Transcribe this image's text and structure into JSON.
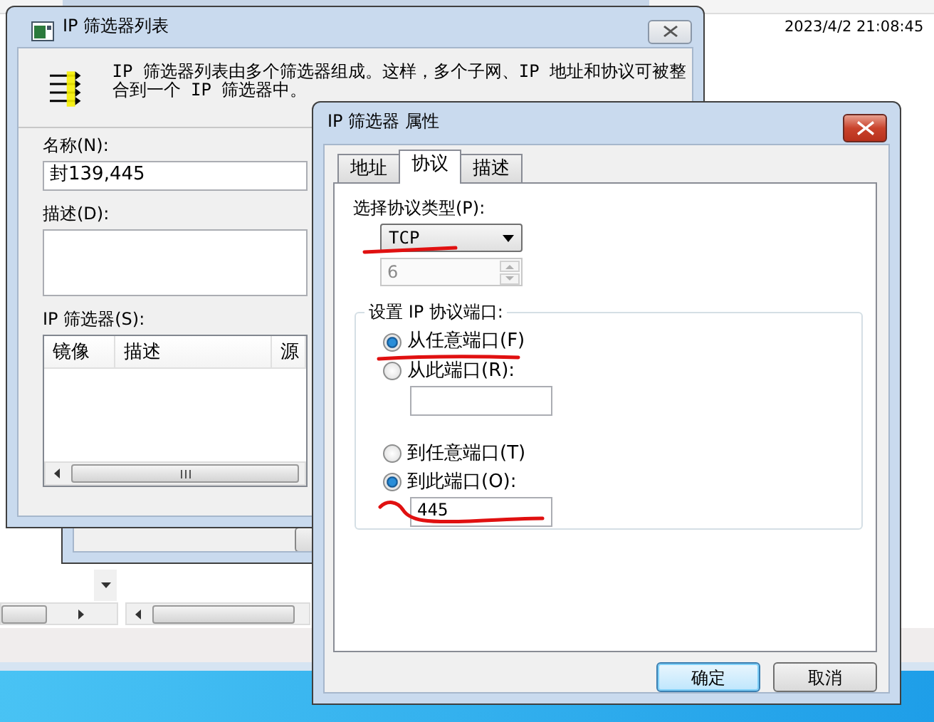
{
  "background_window": {
    "timestamp": "2023/4/2 21:08:45"
  },
  "filter_list_window": {
    "title": "IP 筛选器列表",
    "intro": "IP 筛选器列表由多个筛选器组成。这样，多个子网、IP 地址和协议可被整合到一个 IP 筛选器中。",
    "name_label": "名称(N):",
    "name_value": "封139,445",
    "description_label": "描述(D):",
    "filters_label": "IP 筛选器(S):",
    "filter_columns": [
      "镜像",
      "描述",
      "源"
    ]
  },
  "properties_dialog": {
    "title": "IP 筛选器 属性",
    "tabs": [
      {
        "label": "地址",
        "selected": false
      },
      {
        "label": "协议",
        "selected": true
      },
      {
        "label": "描述",
        "selected": false
      }
    ],
    "protocol_type_label": "选择协议类型(P):",
    "protocol_type": "TCP",
    "protocol_number": {
      "value": "6",
      "disabled": true
    },
    "port_group_label": "设置 IP 协议端口:",
    "source_port": [
      {
        "kind": "option",
        "label": "从任意端口(F)",
        "selected": true
      },
      {
        "kind": "option_with_field",
        "label": "从此端口(R):",
        "selected": false
      }
    ],
    "destination_port": [
      {
        "kind": "option",
        "label": "到任意端口(T)",
        "selected": false
      },
      {
        "kind": "option_with_field",
        "label": "到此端口(O):",
        "selected": true,
        "value": "445"
      }
    ],
    "buttons": [
      {
        "label": "确定",
        "default": true
      },
      {
        "label": "取消",
        "default": false
      }
    ]
  }
}
